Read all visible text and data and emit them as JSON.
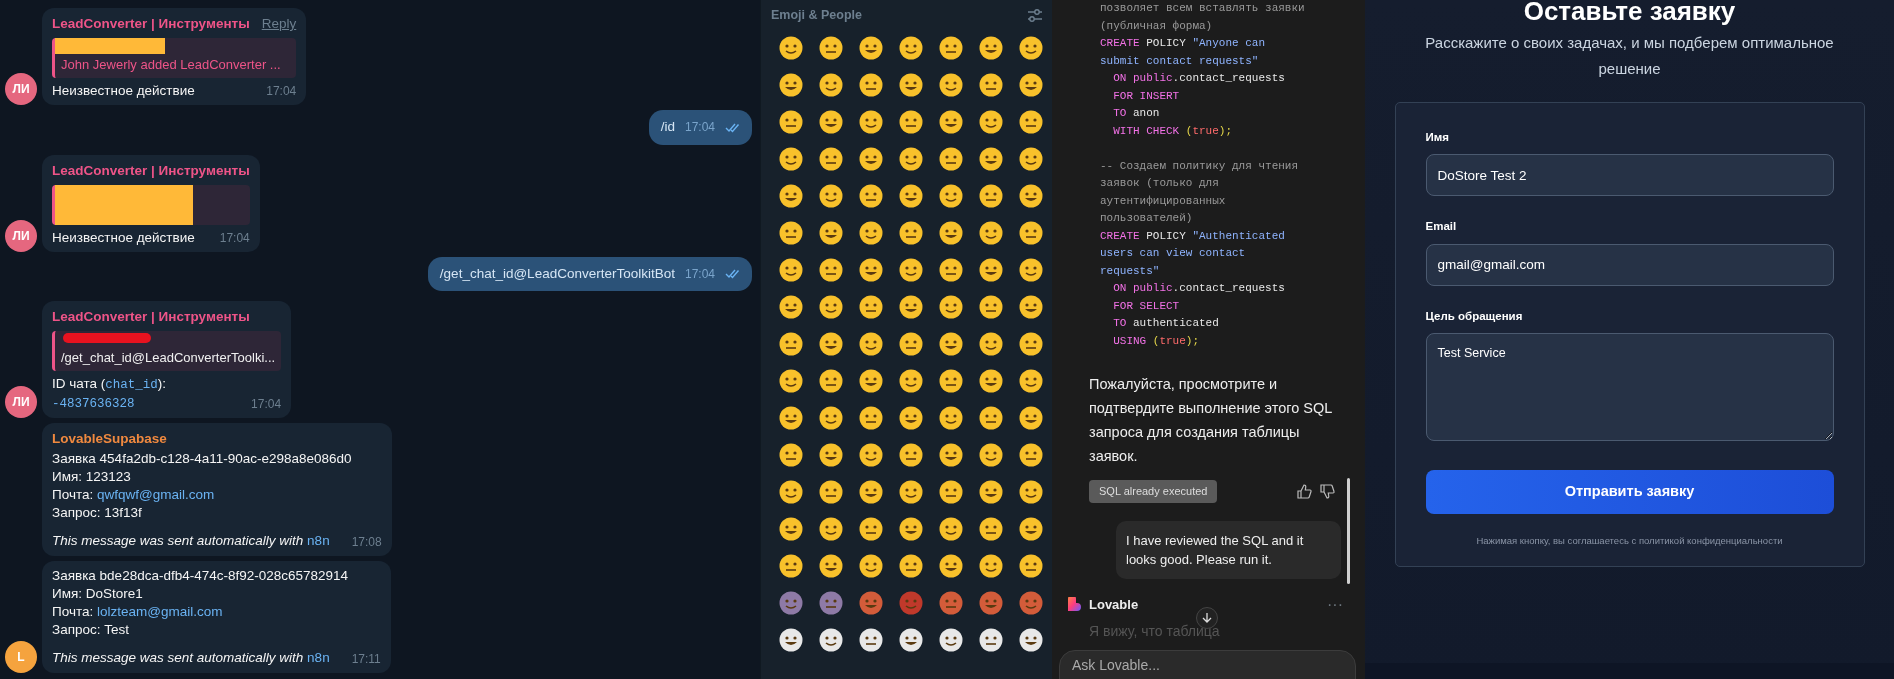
{
  "telegram": {
    "messages": [
      {
        "kind": "incoming",
        "avatar": {
          "initials": "ЛИ",
          "color": "#e5677f"
        },
        "sender": {
          "name": "LeadConverter | Инструменты",
          "color": "#ee5488"
        },
        "reply_action": "Reply",
        "reply": {
          "kind": "service",
          "cover": {
            "color": "#ffb938"
          },
          "text": "John Jewerly added LeadConverter ..."
        },
        "lines": [
          [
            {
              "kind": "text",
              "t": "Неизвестное действие"
            }
          ]
        ],
        "time": "17:04"
      },
      {
        "kind": "outgoing",
        "lines": [
          [
            {
              "kind": "text",
              "t": "/id"
            }
          ]
        ],
        "time": "17:04",
        "read": true
      },
      {
        "kind": "incoming",
        "avatar": {
          "initials": "ЛИ",
          "color": "#e5677f"
        },
        "sender": {
          "name": "LeadConverter | Инструменты",
          "color": "#ee5488"
        },
        "reply": {
          "kind": "service",
          "cover": {
            "color": "#ffb938"
          }
        },
        "lines": [
          [
            {
              "kind": "text",
              "t": "Неизвестное действие"
            }
          ]
        ],
        "time": "17:04"
      },
      {
        "kind": "outgoing",
        "lines": [
          [
            {
              "kind": "text",
              "t": "/get_chat_id@LeadConverterToolkitBot"
            }
          ]
        ],
        "time": "17:04",
        "read": true
      },
      {
        "kind": "incoming",
        "avatar": {
          "initials": "ЛИ",
          "color": "#e5677f"
        },
        "sender": {
          "name": "LeadConverter | Инструменты",
          "color": "#ee5488"
        },
        "reply": {
          "kind": "text",
          "cover": {
            "color": "#e8121f"
          },
          "text": "/get_chat_id@LeadConverterToolki..."
        },
        "lines": [
          [
            {
              "kind": "text",
              "t": "ID чата ("
            },
            {
              "kind": "code",
              "t": "chat_id"
            },
            {
              "kind": "text",
              "t": "):"
            }
          ],
          [
            {
              "kind": "code",
              "t": "-4837636328"
            }
          ]
        ],
        "time": "17:04"
      },
      {
        "kind": "incoming",
        "sender": {
          "name": "LovableSupabase",
          "color": "#f0893f"
        },
        "lines": [
          [
            {
              "kind": "text",
              "t": "Заявка  454fa2db-c128-4a11-90ac-e298a8e086d0"
            }
          ],
          [
            {
              "kind": "text",
              "t": "Имя: 123123"
            }
          ],
          [
            {
              "kind": "text",
              "t": "Почта: "
            },
            {
              "kind": "link",
              "t": "qwfqwf@gmail.com"
            }
          ],
          [
            {
              "kind": "text",
              "t": "Запрос: 13f13f"
            }
          ]
        ],
        "footer": [
          {
            "kind": "italic",
            "t": "This message was sent automatically with "
          },
          {
            "kind": "link",
            "t": "n8n"
          }
        ],
        "time": "17:08"
      },
      {
        "kind": "incoming",
        "avatar": {
          "initials": "L",
          "color": "#f5a33e"
        },
        "lines": [
          [
            {
              "kind": "text",
              "t": "Заявка  bde28dca-dfb4-474c-8f92-028c65782914"
            }
          ],
          [
            {
              "kind": "text",
              "t": "Имя: DoStore1"
            }
          ],
          [
            {
              "kind": "text",
              "t": "Почта: "
            },
            {
              "kind": "link",
              "t": "lolzteam@gmail.com"
            }
          ],
          [
            {
              "kind": "text",
              "t": "Запрос: Test"
            }
          ]
        ],
        "footer": [
          {
            "kind": "italic",
            "t": "This message was sent automatically with "
          },
          {
            "kind": "link",
            "t": "n8n"
          }
        ],
        "time": "17:11"
      }
    ]
  },
  "emoji_panel": {
    "title": "Emoji & People"
  },
  "lovable": {
    "code_blocks": [
      [
        {
          "indent": false,
          "segs": [
            {
              "kind": "comment",
              "t": "позволяет всем вставлять заявки"
            }
          ]
        },
        {
          "indent": false,
          "segs": [
            {
              "kind": "comment",
              "t": "(публичная форма)"
            }
          ]
        },
        {
          "indent": false,
          "segs": [
            {
              "kind": "kw",
              "t": "CREATE"
            },
            {
              "kind": "plain",
              "t": " POLICY "
            },
            {
              "kind": "str",
              "t": "\"Anyone can"
            }
          ]
        },
        {
          "indent": false,
          "segs": [
            {
              "kind": "str",
              "t": "submit contact requests\""
            }
          ]
        },
        {
          "indent": true,
          "segs": [
            {
              "kind": "kw",
              "t": "ON public"
            },
            {
              "kind": "plain",
              "t": ".contact_requests"
            }
          ]
        },
        {
          "indent": true,
          "segs": [
            {
              "kind": "kw",
              "t": "FOR INSERT"
            }
          ]
        },
        {
          "indent": true,
          "segs": [
            {
              "kind": "kw",
              "t": "TO"
            },
            {
              "kind": "plain",
              "t": " anon"
            }
          ]
        },
        {
          "indent": true,
          "segs": [
            {
              "kind": "kw",
              "t": "WITH CHECK"
            },
            {
              "kind": "punct",
              "t": " ("
            },
            {
              "kind": "bool",
              "t": "true"
            },
            {
              "kind": "punct",
              "t": ");"
            }
          ]
        }
      ],
      [
        {
          "indent": false,
          "segs": [
            {
              "kind": "comment",
              "t": "-- Создаем политику для чтения"
            }
          ]
        },
        {
          "indent": false,
          "segs": [
            {
              "kind": "comment",
              "t": "заявок (только для"
            }
          ]
        },
        {
          "indent": false,
          "segs": [
            {
              "kind": "comment",
              "t": "аутентифицированных"
            }
          ]
        },
        {
          "indent": false,
          "segs": [
            {
              "kind": "comment",
              "t": "пользователей)"
            }
          ]
        },
        {
          "indent": false,
          "segs": [
            {
              "kind": "kw",
              "t": "CREATE"
            },
            {
              "kind": "plain",
              "t": " POLICY "
            },
            {
              "kind": "str",
              "t": "\"Authenticated"
            }
          ]
        },
        {
          "indent": false,
          "segs": [
            {
              "kind": "str",
              "t": "users can view contact"
            }
          ]
        },
        {
          "indent": false,
          "segs": [
            {
              "kind": "str",
              "t": "requests\""
            }
          ]
        },
        {
          "indent": true,
          "segs": [
            {
              "kind": "kw",
              "t": "ON public"
            },
            {
              "kind": "plain",
              "t": ".contact_requests"
            }
          ]
        },
        {
          "indent": true,
          "segs": [
            {
              "kind": "kw",
              "t": "FOR SELECT"
            }
          ]
        },
        {
          "indent": true,
          "segs": [
            {
              "kind": "kw",
              "t": "TO"
            },
            {
              "kind": "plain",
              "t": " authenticated"
            }
          ]
        },
        {
          "indent": true,
          "segs": [
            {
              "kind": "kw",
              "t": "USING"
            },
            {
              "kind": "punct",
              "t": " ("
            },
            {
              "kind": "bool",
              "t": "true"
            },
            {
              "kind": "punct",
              "t": ");"
            }
          ]
        }
      ]
    ],
    "message": "Пожалуйста, просмотрите и подтвердите выполнение этого SQL запроса для создания таблицы заявок.",
    "action": {
      "label": "SQL already executed",
      "disabled": true
    },
    "user_message": "I have reviewed the SQL and it looks good. Please run it.",
    "agent_name": "Lovable",
    "more": "···",
    "reply_preview": "Я вижу, что таблица",
    "input": {
      "placeholder": "Ask Lovable..."
    }
  },
  "form": {
    "title": "Оставьте заявку",
    "subtitle": "Расскажите о своих задачах, и мы подберем оптимальное решение",
    "fields": [
      {
        "kind": "input",
        "label": "Имя",
        "value": "DoStore Test 2"
      },
      {
        "kind": "input",
        "label": "Email",
        "value": "gmail@gmail.com"
      },
      {
        "kind": "textarea",
        "label": "Цель обращения",
        "value": "Test Service"
      }
    ],
    "submit": "Отправить заявку",
    "note": "Нажимая кнопку, вы соглашаетесь с политикой конфиденциальности"
  }
}
